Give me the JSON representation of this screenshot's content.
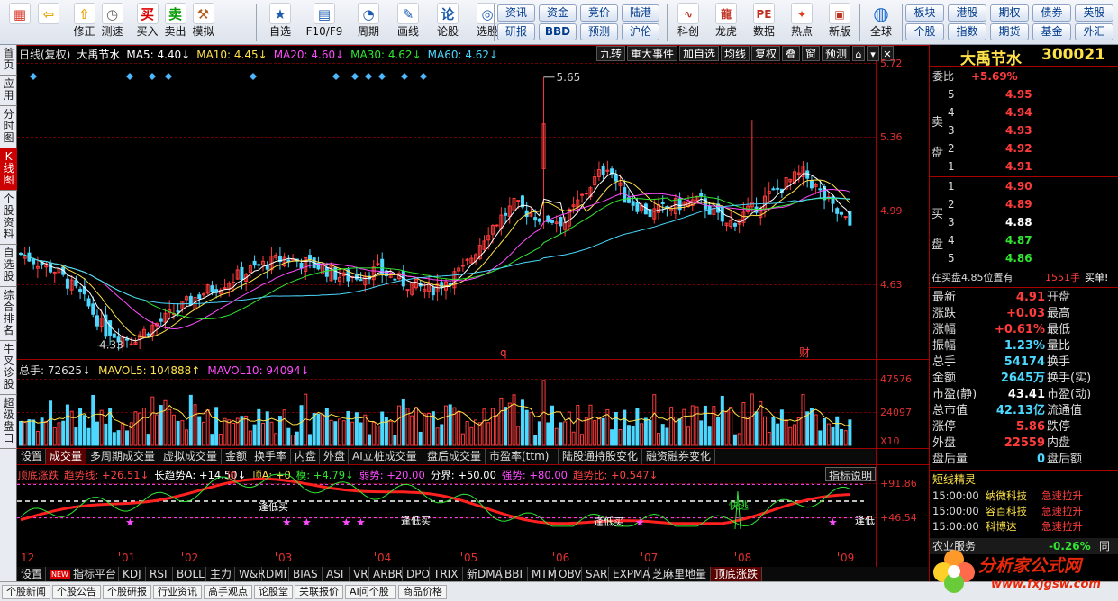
{
  "toolbar": {
    "left": [
      {
        "label": "",
        "icon": "windows-icon",
        "color": "#d83a2a"
      },
      {
        "label": "",
        "icon": "back-arrow-icon",
        "color": "#e8a60a"
      },
      {
        "label": "修正",
        "icon": "up-arrow-icon",
        "color": "#e8a60a"
      },
      {
        "label": "测速",
        "icon": "clock-icon",
        "color": "#666"
      },
      {
        "label": "买入",
        "icon": "buy-icon",
        "color": "#d00"
      },
      {
        "label": "卖出",
        "icon": "sell-icon",
        "color": "#090"
      },
      {
        "label": "模拟",
        "icon": "hammer-icon",
        "color": "#b45a18"
      }
    ],
    "mid": [
      {
        "label": "自选",
        "icon": "star-icon"
      },
      {
        "label": "F10/F9",
        "icon": "f10-icon"
      },
      {
        "label": "周期",
        "icon": "period-icon"
      },
      {
        "label": "画线",
        "icon": "pencil-icon"
      },
      {
        "label": "论股",
        "icon": "forum-icon"
      },
      {
        "label": "选股",
        "icon": "select-stock-icon"
      }
    ],
    "info": [
      "资讯",
      "资金",
      "竞价",
      "陆港",
      "研报",
      "BBD",
      "预测",
      "沪伦"
    ],
    "tools": [
      {
        "label": "科创",
        "icon": "kechuang-icon"
      },
      {
        "label": "龙虎",
        "icon": "dragon-tiger-icon"
      },
      {
        "label": "数据",
        "icon": "pe-icon"
      },
      {
        "label": "热点",
        "icon": "hot-icon"
      },
      {
        "label": "新版",
        "icon": "new-version-icon"
      }
    ],
    "globe": {
      "label": "全球",
      "icon": "globe-icon"
    },
    "right": [
      "板块",
      "港股",
      "期权",
      "债券",
      "英股",
      "个股",
      "指数",
      "期货",
      "基金",
      "外汇"
    ]
  },
  "vtabs": [
    "首页",
    "应用",
    "分时图",
    "K线图",
    "个股资料",
    "自选股",
    "综合排名",
    "牛叉诊股",
    "超级盘口"
  ],
  "kchart": {
    "header": [
      {
        "text": "日线(复权)",
        "color": "#ddd"
      },
      {
        "text": "大禹节水",
        "color": "#fff"
      },
      {
        "text": "MA5: 4.40↓",
        "color": "#fff"
      },
      {
        "text": "MA10: 4.45↓",
        "color": "#ffe24a"
      },
      {
        "text": "MA20: 4.60↓",
        "color": "#ff4cff"
      },
      {
        "text": "MA30: 4.62↓",
        "color": "#32e632"
      },
      {
        "text": "MA60: 4.62↓",
        "color": "#4cd8ff"
      }
    ],
    "buttons": [
      "九转",
      "重大事件",
      "加自选",
      "均线",
      "复权",
      "叠",
      "窗",
      "预测"
    ],
    "yaxis": [
      "5.72",
      "5.36",
      "4.99",
      "4.63"
    ],
    "high_label": "5.65",
    "low_label": "4.33",
    "q_marker": "q",
    "cai_marker": "财"
  },
  "volume": {
    "header": [
      {
        "text": "总手: 72625↓",
        "color": "#ddd"
      },
      {
        "text": "MAVOL5: 104888↑",
        "color": "#ffe24a"
      },
      {
        "text": "MAVOL10: 94094↓",
        "color": "#ff4cff"
      }
    ],
    "yaxis": [
      "47576",
      "24097",
      "X10"
    ]
  },
  "subtabs": [
    "设置",
    "成交量",
    "多周期成交量",
    "虚拟成交量",
    "金额",
    "换手率",
    "内盘",
    "外盘",
    "AI立桩成交量",
    "盘后成交量",
    "市盈率(ttm)",
    "陆股通持股变化",
    "融资融券变化"
  ],
  "indicator": {
    "header": [
      {
        "text": "顶底涨跌",
        "color": "#ff4444"
      },
      {
        "text": "趋势线: +26.51↓",
        "color": "#ff4444"
      },
      {
        "text": "长趋势A: +14.50↓",
        "color": "#fff"
      },
      {
        "text": "顶A: +0",
        "color": "#ffe24a"
      },
      {
        "text": "模: +4.79↓",
        "color": "#32e632"
      },
      {
        "text": "弱势: +20.00",
        "color": "#ff4cff"
      },
      {
        "text": "分界: +50.00",
        "color": "#fff"
      },
      {
        "text": "强势: +80.00",
        "color": "#ff4cff"
      },
      {
        "text": "趋势比: +0.547↓",
        "color": "#ff4444"
      }
    ],
    "explain": "指标说明",
    "yaxis": [
      "+91.86",
      "+46.54"
    ],
    "labels": [
      "逢低买",
      "逢低买",
      "逢低买",
      "快逃",
      "逢低",
      "顶"
    ]
  },
  "xaxis": [
    "12",
    "01",
    "02",
    "03",
    "04",
    "05",
    "06",
    "07",
    "08",
    "09"
  ],
  "bottom_tabs": [
    "设置",
    "指标平台",
    "KDJ",
    "RSI",
    "BOLL",
    "主力",
    "W&R",
    "DMI",
    "BIAS",
    "ASI",
    "VR",
    "ARBR",
    "DPO",
    "TRIX",
    "新DMA",
    "BBI",
    "MTM",
    "OBV",
    "SAR",
    "EXPMA",
    "芝麻里地量",
    "顶底涨跌"
  ],
  "new_badge": "NEW",
  "status": [
    "个股新闻",
    "个股公告",
    "个股研报",
    "行业资讯",
    "高手观点",
    "论股堂",
    "关联报价",
    "AI问个股",
    "商品价格"
  ],
  "quote": {
    "name": "大禹节水",
    "code": "300021",
    "weibi_label": "委比",
    "weibi": "+5.69%",
    "sell_label": "卖盘",
    "buy_label": "买盘",
    "sell": [
      {
        "lv": "5",
        "price": "4.95",
        "vol": ""
      },
      {
        "lv": "4",
        "price": "4.94",
        "vol": ""
      },
      {
        "lv": "3",
        "price": "4.93",
        "vol": ""
      },
      {
        "lv": "2",
        "price": "4.92",
        "vol": ""
      },
      {
        "lv": "1",
        "price": "4.91",
        "vol": ""
      }
    ],
    "buy": [
      {
        "lv": "1",
        "price": "4.90",
        "vol": ""
      },
      {
        "lv": "2",
        "price": "4.89",
        "vol": ""
      },
      {
        "lv": "3",
        "price": "4.88",
        "vol": ""
      },
      {
        "lv": "4",
        "price": "4.87",
        "vol": ""
      },
      {
        "lv": "5",
        "price": "4.86",
        "vol": ""
      }
    ],
    "note": "在买盘4.85位置有",
    "note_vol": "1551手",
    "note_tail": "买单!",
    "stats": [
      [
        "最新",
        "4.91",
        "red",
        "开盘",
        ""
      ],
      [
        "涨跌",
        "+0.03",
        "red",
        "最高",
        ""
      ],
      [
        "涨幅",
        "+0.61%",
        "red",
        "最低",
        ""
      ],
      [
        "振幅",
        "1.23%",
        "cyan",
        "量比",
        ""
      ],
      [
        "总手",
        "54174",
        "cyan",
        "换手",
        ""
      ],
      [
        "金额",
        "2645万",
        "cyan",
        "换手(实)",
        ""
      ],
      [
        "市盈(静)",
        "43.41",
        "wht",
        "市盈(动)",
        ""
      ],
      [
        "总市值",
        "42.13亿",
        "cyan",
        "流通值",
        ""
      ],
      [
        "涨停",
        "5.86",
        "red",
        "跌停",
        ""
      ],
      [
        "外盘",
        "22559",
        "red",
        "内盘",
        ""
      ],
      [
        "盘后量",
        "0",
        "cyan",
        "盘后额",
        ""
      ]
    ],
    "news_title": "短线精灵",
    "news": [
      [
        "15:00:00",
        "纳微科技",
        "急速拉升"
      ],
      [
        "15:00:00",
        "容百科技",
        "急速拉升"
      ],
      [
        "15:00:00",
        "科博达",
        "急速拉升"
      ]
    ],
    "sector": "农业服务",
    "sector_chg": "-0.26%",
    "sector_more": "同"
  },
  "watermark": {
    "title": "分析家公式网",
    "url": "www.fxjgsw.com"
  },
  "colors": {
    "up": "#ff3c3c",
    "down": "#4cd8ff",
    "ma5": "#ffffff",
    "ma10": "#ffe24a",
    "ma20": "#ff4cff",
    "ma30": "#32e632",
    "ma60": "#4cd8ff"
  }
}
